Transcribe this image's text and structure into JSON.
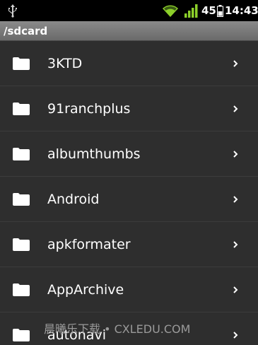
{
  "status_bar": {
    "battery_level": "45",
    "time": "14:43",
    "icons": [
      "usb-icon",
      "wifi-icon",
      "signal-icon",
      "battery-icon"
    ]
  },
  "path": "/sdcard",
  "folders": [
    {
      "name": "3KTD",
      "icon": "folder-icon"
    },
    {
      "name": "91ranchplus",
      "icon": "folder-icon"
    },
    {
      "name": "albumthumbs",
      "icon": "folder-icon"
    },
    {
      "name": "Android",
      "icon": "folder-icon"
    },
    {
      "name": "apkformater",
      "icon": "folder-icon"
    },
    {
      "name": "AppArchive",
      "icon": "folder-icon"
    },
    {
      "name": "autonavi",
      "icon": "folder-icon"
    }
  ],
  "watermark": "晨曦乐下载 • CXLEDU.COM",
  "colors": {
    "background": "#2b2b2b",
    "status_bar": "#000000",
    "signal_green": "#8ccf2a",
    "path_bar": "#7a7a7a",
    "text": "#ffffff"
  }
}
